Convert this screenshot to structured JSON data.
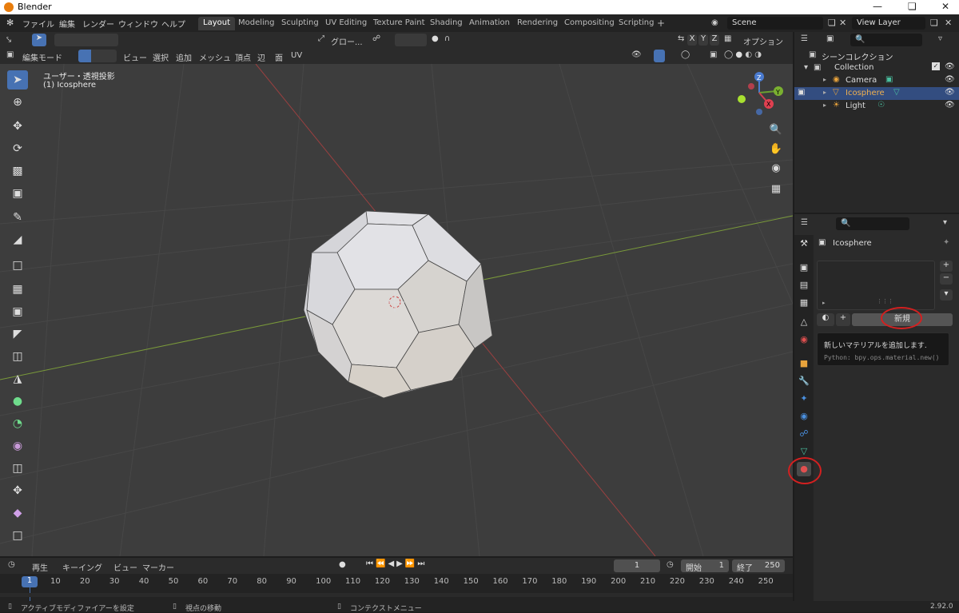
{
  "window": {
    "title": "Blender"
  },
  "menu": {
    "items": [
      "ファイル",
      "編集",
      "レンダー",
      "ウィンドウ",
      "ヘルプ"
    ]
  },
  "workspaces": [
    "Layout",
    "Modeling",
    "Sculpting",
    "UV Editing",
    "Texture Paint",
    "Shading",
    "Animation",
    "Rendering",
    "Compositing",
    "Scripting"
  ],
  "scene": {
    "name": "Scene",
    "view_layer": "View Layer"
  },
  "viewport_header": {
    "orientation": "グロー...",
    "options": "オプション",
    "axes": [
      "X",
      "Y",
      "Z"
    ]
  },
  "viewport_header2": {
    "mode": "編集モード",
    "menus": [
      "ビュー",
      "選択",
      "追加",
      "メッシュ",
      "頂点",
      "辺",
      "面",
      "UV"
    ]
  },
  "viewport": {
    "view_name": "ユーザー・透視投影",
    "object_label": "(1) Icosphere",
    "gizmo_axes": [
      "Z",
      "Y",
      "X"
    ]
  },
  "outliner": {
    "root": "シーンコレクション",
    "collection": "Collection",
    "objects": [
      "Camera",
      "Icosphere",
      "Light"
    ]
  },
  "properties": {
    "object_name": "Icosphere",
    "new_button": "新規",
    "tooltip_title": "新しいマテリアルを追加します.",
    "tooltip_python": "Python: bpy.ops.material.new()"
  },
  "timeline_header": {
    "menus": [
      "再生",
      "キーイング",
      "ビュー",
      "マーカー"
    ],
    "current_frame": "1",
    "start_label": "開始",
    "start": "1",
    "end_label": "終了",
    "end": "250"
  },
  "timeline": {
    "current": "1",
    "ticks": [
      "10",
      "20",
      "30",
      "40",
      "50",
      "60",
      "70",
      "80",
      "90",
      "100",
      "110",
      "120",
      "130",
      "140",
      "150",
      "160",
      "170",
      "180",
      "190",
      "200",
      "210",
      "220",
      "230",
      "240",
      "250"
    ]
  },
  "status": {
    "left": "アクティブモディファイアーを設定",
    "middle": "視点の移動",
    "right": "コンテクストメニュー",
    "version": "2.92.0"
  },
  "colors": {
    "accent": "#4772b3",
    "selection": "#334d80",
    "highlight": "#d42020",
    "object_orange": "#e8a33c"
  }
}
